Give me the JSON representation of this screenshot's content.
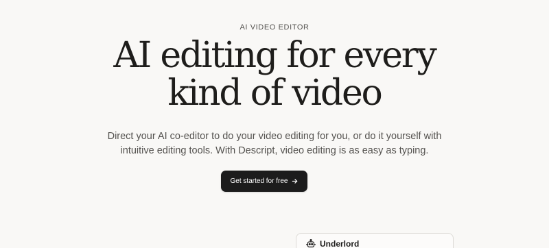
{
  "hero": {
    "eyebrow": "AI VIDEO EDITOR",
    "headline_line1": "AI editing for every",
    "headline_line2": "kind of video",
    "subtitle_line1": "Direct your AI co-editor to do your video editing for you, or do it yourself with",
    "subtitle_line2": "intuitive editing tools. With Descript, video editing is as easy as typing.",
    "cta_label": "Get started for free",
    "cta_icon": "arrow-right-icon"
  },
  "preview_panel": {
    "title": "Underlord",
    "icon": "robot-icon"
  },
  "colors": {
    "background": "#f9f8f6",
    "button_bg": "#1c1c1c",
    "button_text": "#ffffff"
  }
}
